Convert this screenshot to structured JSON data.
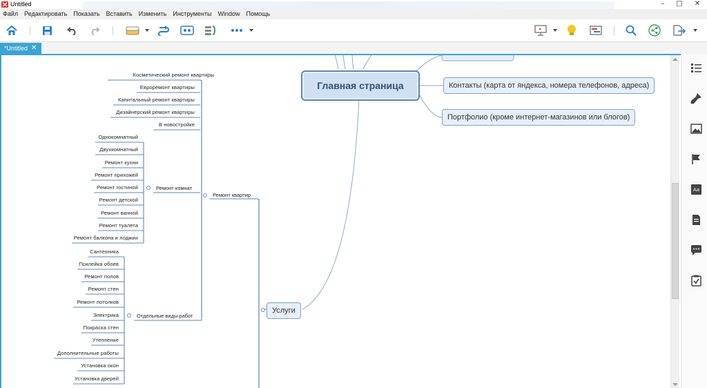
{
  "window": {
    "title": "Untitled",
    "minimize": "–",
    "maximize": "□",
    "close": "✕"
  },
  "menu": [
    "Файл",
    "Редактировать",
    "Показать",
    "Вставить",
    "Изменить",
    "Инструменты",
    "Window",
    "Помощь"
  ],
  "toolbar": {
    "icons": [
      "home-icon",
      "save-icon",
      "undo-icon",
      "redo-icon",
      "topic-icon",
      "relationship-icon",
      "summary-icon",
      "boundary-icon",
      "more-icon",
      "presentation-icon",
      "idea-icon",
      "gantt-icon",
      "search-icon",
      "share-icon",
      "export-icon"
    ]
  },
  "tabs": [
    {
      "label": "*Untitled",
      "active": true
    }
  ],
  "colors": {
    "accent": "#3aa4d4",
    "node_border": "#7fa2c7",
    "node_fill": "#e7f0f9",
    "line": "#5b87b8"
  },
  "mindmap": {
    "central": "Главная страница",
    "top_right": [
      "Контакты (карта от яндекса, номера телефонов, адреса)",
      "Портфолио (кроме интернет-магазинов или блогов)"
    ],
    "services": "Услуги",
    "renovation": "Ремонт квартир",
    "renovation_types": [
      "Косметический ремонт квартиры",
      "Евроремонт квартиры",
      "Капитальный ремонт квартиры",
      "Дизайнерский ремонт квартиры",
      "В новостройке"
    ],
    "rooms_group": "Ремонт комнат",
    "rooms": [
      "Однокомнатный",
      "Двухкомнатный",
      "Ремонт кухни",
      "Ремонт прихожей",
      "Ремонт гостиной",
      "Ремонт детской",
      "Ремонт ванной",
      "Ремонт туалета",
      "Ремонт балкона и лоджии"
    ],
    "works_group": "Отдельные виды работ",
    "works": [
      "Сантехника",
      "Поклейка обоев",
      "Ремонт полов",
      "Ремонт стен",
      "Ремонт потолков",
      "Электрика",
      "Покраска стен",
      "Утепление",
      "Дополнительные работы",
      "Установка окон",
      "Установка дверей"
    ]
  },
  "sidebar": {
    "icons": [
      "outline-icon",
      "format-brush-icon",
      "image-icon",
      "marker-flag-icon",
      "text-style-icon",
      "notes-icon",
      "comments-icon",
      "task-icon"
    ]
  }
}
